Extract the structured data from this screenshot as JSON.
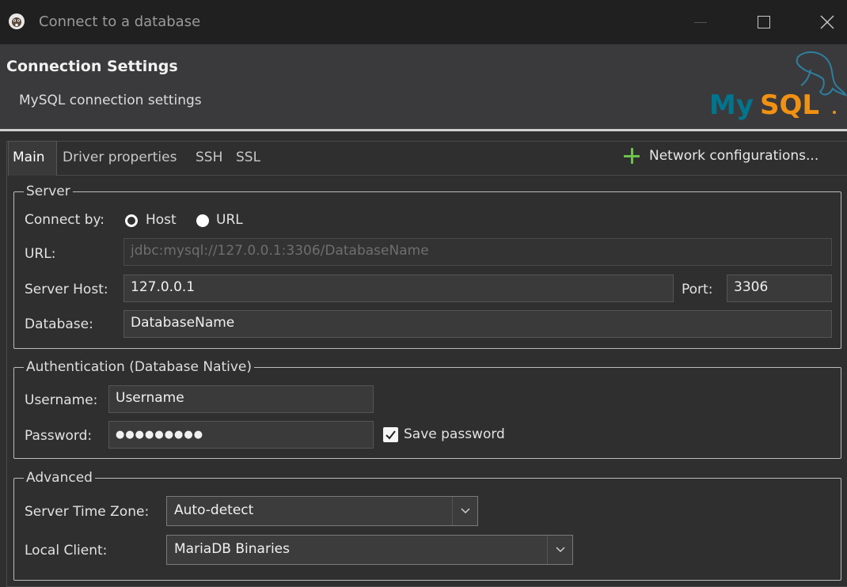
{
  "window": {
    "title": "Connect to a database",
    "app_icon": "dbeaver-beaver-icon",
    "controls": [
      "minimize-icon",
      "maximize-icon",
      "close-icon"
    ]
  },
  "header": {
    "title": "Connection Settings",
    "subtitle": "MySQL connection settings",
    "logo_text_my": "My",
    "logo_text_sql": "SQL",
    "logo_colors": {
      "my": "#00758f",
      "sql": "#f29111"
    }
  },
  "tabs": {
    "main": "Main",
    "driver": "Driver properties",
    "ssh": "SSH",
    "ssl": "SSL",
    "network": "Network configurations...",
    "network_icon": "plus-icon"
  },
  "server": {
    "legend": "Server",
    "connect_by_label": "Connect by:",
    "option_host": "Host",
    "option_url": "URL",
    "selected": "Host",
    "url_label": "URL:",
    "url_value": "jdbc:mysql://127.0.0.1:3306/DatabaseName",
    "host_label": "Server Host:",
    "host_value": "127.0.0.1",
    "port_label": "Port:",
    "port_value": "3306",
    "database_label": "Database:",
    "database_value": "DatabaseName"
  },
  "auth": {
    "legend": "Authentication (Database Native)",
    "username_label": "Username:",
    "username_value": "Username",
    "password_label": "Password:",
    "password_value": "●●●●●●●●●",
    "save_password_label": "Save password",
    "save_password_checked": true
  },
  "advanced": {
    "legend": "Advanced",
    "timezone_label": "Server Time Zone:",
    "timezone_value": "Auto-detect",
    "local_client_label": "Local Client:",
    "local_client_value": "MariaDB Binaries"
  },
  "colors": {
    "accent_green": "#6cc24a",
    "background": "#2f2f2f"
  }
}
